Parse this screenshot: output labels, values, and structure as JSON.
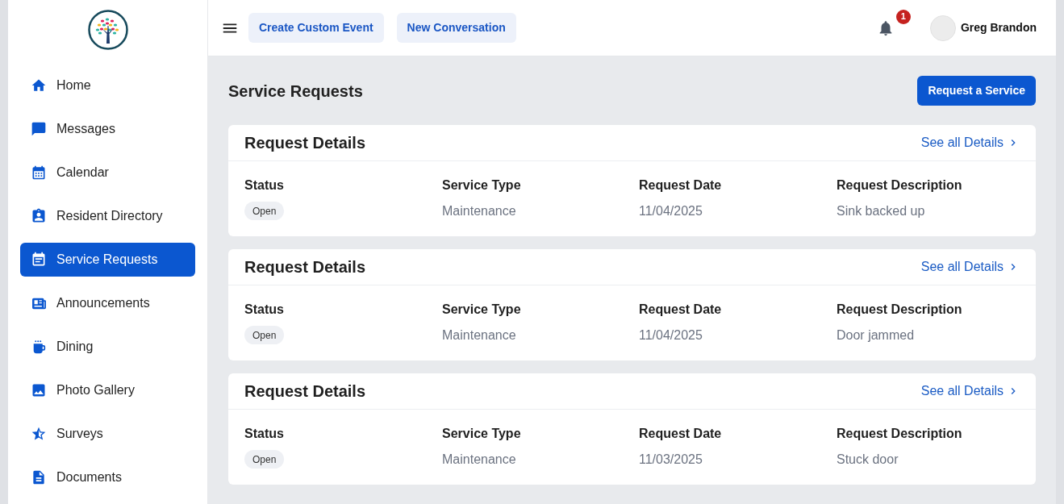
{
  "sidebar": {
    "items": [
      {
        "label": "Home",
        "selected": false
      },
      {
        "label": "Messages",
        "selected": false
      },
      {
        "label": "Calendar",
        "selected": false
      },
      {
        "label": "Resident Directory",
        "selected": false
      },
      {
        "label": "Service Requests",
        "selected": true
      },
      {
        "label": "Announcements",
        "selected": false
      },
      {
        "label": "Dining",
        "selected": false
      },
      {
        "label": "Photo Gallery",
        "selected": false
      },
      {
        "label": "Surveys",
        "selected": false
      },
      {
        "label": "Documents",
        "selected": false
      }
    ]
  },
  "header": {
    "buttons": [
      "Create Custom Event",
      "New Conversation"
    ],
    "notifications": {
      "count": "1"
    },
    "user": {
      "name": "Greg Brandon"
    }
  },
  "page": {
    "title": "Service Requests",
    "action": "Request a Service"
  },
  "requests": [
    {
      "title": "Request Details",
      "link": "See all Details",
      "fields": [
        {
          "label": "Status",
          "value": "Open",
          "kind": "badge"
        },
        {
          "label": "Service Type",
          "value": "Maintenance",
          "kind": "text"
        },
        {
          "label": "Request Date",
          "value": "11/04/2025",
          "kind": "text"
        },
        {
          "label": "Request Description",
          "value": "Sink backed up",
          "kind": "text"
        }
      ]
    },
    {
      "title": "Request Details",
      "link": "See all Details",
      "fields": [
        {
          "label": "Status",
          "value": "Open",
          "kind": "badge"
        },
        {
          "label": "Service Type",
          "value": "Maintenance",
          "kind": "text"
        },
        {
          "label": "Request Date",
          "value": "11/04/2025",
          "kind": "text"
        },
        {
          "label": "Request Description",
          "value": "Door jammed",
          "kind": "text"
        }
      ]
    },
    {
      "title": "Request Details",
      "link": "See all Details",
      "fields": [
        {
          "label": "Status",
          "value": "Open",
          "kind": "badge"
        },
        {
          "label": "Service Type",
          "value": "Maintenance",
          "kind": "text"
        },
        {
          "label": "Request Date",
          "value": "11/03/2025",
          "kind": "text"
        },
        {
          "label": "Request Description",
          "value": "Stuck door",
          "kind": "text"
        }
      ]
    }
  ]
}
